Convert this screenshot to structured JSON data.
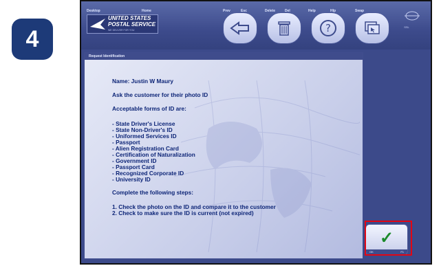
{
  "step": {
    "number": "4"
  },
  "topbar": {
    "labels": {
      "desktop": "Desktop",
      "home": "Home",
      "prev": "Prev",
      "prev_key": "Esc",
      "delete": "Delete",
      "delete_key": "Del",
      "help": "Help",
      "help_key": "Hlp",
      "swap": "Swap"
    },
    "logo": {
      "line1": "UNITED STATES",
      "line2": "POSTAL SERVICE",
      "tagline": "WE DELIVER FOR YOU"
    },
    "ssl_caption": "SSL"
  },
  "panel": {
    "title": "Request Identification",
    "name_line": "Name: Justin W Maury",
    "ask_line": "Ask the customer for their photo ID",
    "acceptable_heading": "Acceptable forms of ID are:",
    "id_forms": [
      "-  State Driver's License",
      "-  State Non-Driver's ID",
      "-  Uniformed Services ID",
      "-  Passport",
      "-  Alien Registration Card",
      "-  Certification of Naturalization",
      "-  Government ID",
      "-  Passport Card",
      "-  Recognized Corporate ID",
      "-  University ID"
    ],
    "steps_heading": "Complete the following steps:",
    "steps": [
      "1. Check the photo on the ID and compare it to the customer",
      "2. Check to make sure the ID is current (not expired)"
    ]
  },
  "ok_button": {
    "label": "OK",
    "key": "F1",
    "icon": "checkmark-icon"
  },
  "colors": {
    "accent_red": "#e30613",
    "badge_blue": "#1d3a78",
    "check_green": "#1a8a2a"
  }
}
